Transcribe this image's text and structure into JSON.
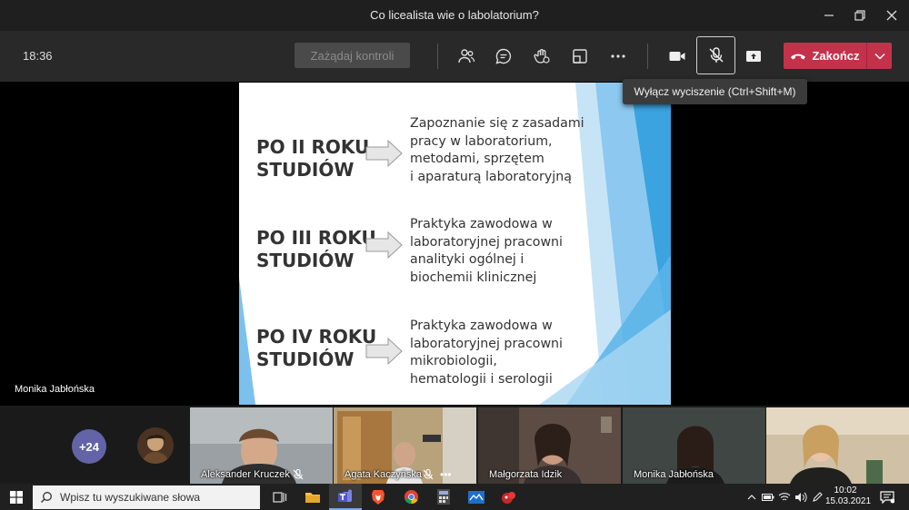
{
  "window": {
    "title": "Co licealista wie o labolatorium?",
    "controls": [
      "minimize-icon",
      "restore-icon",
      "close-icon"
    ]
  },
  "toolbar": {
    "time": "18:36",
    "request_control_label": "Zażądaj kontroli",
    "icons": [
      "participants-icon",
      "chat-icon",
      "reactions-icon",
      "rooms-icon",
      "more-icon",
      "camera-icon",
      "mic-off-icon",
      "share-icon"
    ],
    "end_call_label": "Zakończ",
    "end_call_color": "#c4314b",
    "tooltip": "Wyłącz wyciszenie (Ctrl+Shift+M)"
  },
  "stage": {
    "presenter_name": "Monika Jabłońska",
    "slide": {
      "accent_colors": [
        "#3aa3e0",
        "#8cc8f0",
        "#c7e4f7"
      ],
      "rows": [
        {
          "heading": [
            "PO II ROKU",
            "STUDIÓW"
          ],
          "description": [
            "Zapoznanie się z zasadami",
            "pracy w laboratorium,",
            "metodami, sprzętem",
            "i aparaturą laboratoryjną"
          ]
        },
        {
          "heading": [
            "PO III ROKU",
            "STUDIÓW"
          ],
          "description": [
            "Praktyka zawodowa w",
            "laboratoryjnej pracowni",
            "analityki ogólnej i",
            "biochemii klinicznej"
          ]
        },
        {
          "heading": [
            "PO IV ROKU",
            "STUDIÓW"
          ],
          "description": [
            "Praktyka zawodowa w",
            "laboratoryjnej pracowni",
            "mikrobiologii,",
            "hematologii i serologii"
          ]
        }
      ]
    }
  },
  "participants": {
    "more_count": "+24",
    "tiles": [
      {
        "name": "Aleksander Kruczek",
        "muted": true
      },
      {
        "name": "Agata Kaczyńska",
        "muted": true
      },
      {
        "name": "Małgorzata Idzik",
        "muted": false
      },
      {
        "name": "Monika Jabłońska",
        "muted": false
      },
      {
        "name": "",
        "muted": false
      }
    ]
  },
  "taskbar": {
    "search_placeholder": "Wpisz tu wyszukiwane słowa",
    "apps": [
      "task-view-icon",
      "file-explorer-icon",
      "teams-icon",
      "brave-icon",
      "chrome-icon",
      "calculator-icon",
      "whiteboard-icon",
      "app-icon"
    ],
    "clock_time": "10:02",
    "clock_date": "15.03.2021"
  }
}
